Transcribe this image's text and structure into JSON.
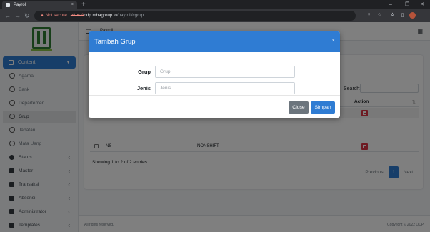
{
  "browser": {
    "tab_title": "Payroll",
    "new_tab_symbol": "+",
    "not_secure": "Not secure",
    "url_scheme": "https://",
    "url_host": "odp.mbagroup.io",
    "url_path": "/payroll/cgrup"
  },
  "sidebar": {
    "section_label": "Content",
    "content_items": [
      "Agama",
      "Bank",
      "Departemen",
      "Grup",
      "Jabatan",
      "Mata Uang"
    ],
    "active_item": "Grup",
    "groups": [
      "Status",
      "Master",
      "Transaksi",
      "Absensi",
      "Administrator",
      "Templates"
    ]
  },
  "topnav": {
    "breadcrumb": "Payroll"
  },
  "table": {
    "search_label": "Search:",
    "action_header": "Action",
    "rows": [
      {
        "kode": "",
        "jenis": ""
      },
      {
        "kode": "NS",
        "jenis": "NONSHIFT"
      }
    ],
    "showing_text": "Showing 1 to 2 of 2 entries",
    "pager": {
      "previous": "Previous",
      "current": "1",
      "next": "Next"
    }
  },
  "footer": {
    "left": "All rights reserved.",
    "right": "Copyright © 2022 ODP."
  },
  "modal": {
    "title": "Tambah Grup",
    "close_symbol": "×",
    "fields": [
      {
        "label": "Grup",
        "placeholder": "Grup"
      },
      {
        "label": "Jenis",
        "placeholder": "Jenis"
      }
    ],
    "close_button": "Close",
    "save_button": "Simpan"
  },
  "colors": {
    "primary": "#2f7cd3",
    "secondary": "#6c757d",
    "danger": "#dc3545"
  }
}
